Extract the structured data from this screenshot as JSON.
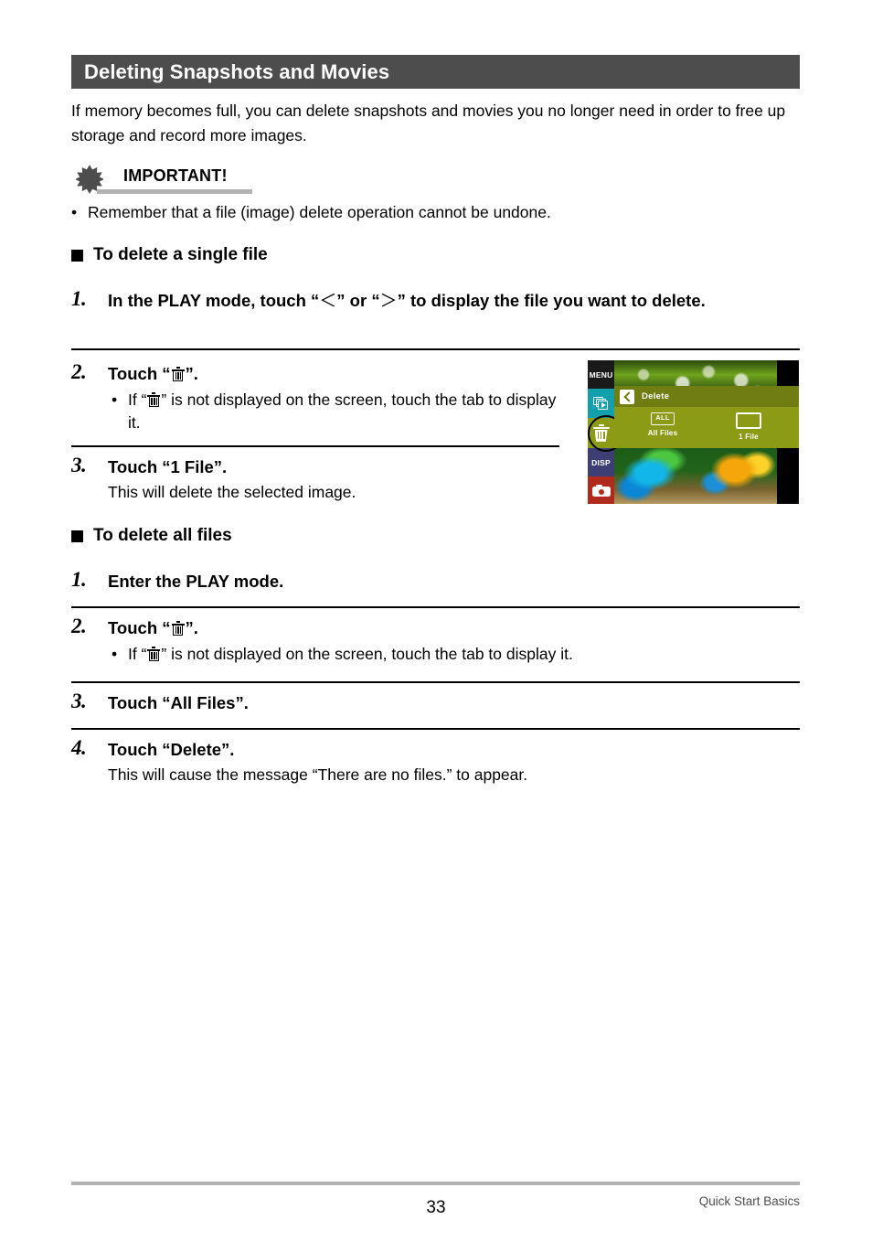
{
  "section": {
    "title": "Deleting Snapshots and Movies",
    "intro": "If memory becomes full, you can delete snapshots and movies you no longer need in order to free up storage and record more images."
  },
  "important": {
    "icon": "starburst-icon",
    "label": "IMPORTANT!",
    "bullet": "Remember that a file (image) delete operation cannot be undone."
  },
  "single_file": {
    "heading": "To delete a single file",
    "step1": {
      "num": "1.",
      "title_pre": "In the PLAY mode, touch “",
      "angle_left": "＜",
      "title_mid": "” or “",
      "angle_right": "＞",
      "title_post": "” to display the file you want to delete."
    },
    "step2": {
      "num": "2.",
      "title_pre": "Touch “",
      "title_post": "”.",
      "bullet_dot": "•",
      "bullet_pre": "If “",
      "bullet_post": "” is not displayed on the screen, touch the tab to display it."
    },
    "step3": {
      "num": "3.",
      "title": "Touch “1 File”.",
      "note": "This will delete the selected image."
    }
  },
  "all_files": {
    "heading": "To delete all files",
    "step1": {
      "num": "1.",
      "title": "Enter the PLAY mode."
    },
    "step2": {
      "num": "2.",
      "title_pre": "Touch “",
      "title_post": "”.",
      "bullet_dot": "•",
      "bullet_pre": "If “",
      "bullet_post": "” is not displayed on the screen, touch the tab to display it."
    },
    "step3": {
      "num": "3.",
      "title": "Touch “All Files”."
    },
    "step4": {
      "num": "4.",
      "title": "Touch “Delete”.",
      "note": "This will cause the message “There are no files.” to appear."
    }
  },
  "lcd": {
    "tabs": [
      {
        "name": "menu-tab",
        "label": "MENU",
        "color": "#1a1a1a"
      },
      {
        "name": "play-tab",
        "label": "",
        "color": "#12a0ad"
      },
      {
        "name": "delete-tab",
        "label": "",
        "color": "#8b9b15"
      },
      {
        "name": "disp-tab",
        "label": "DISP",
        "color": "#3d3f74"
      },
      {
        "name": "camera-tab",
        "label": "",
        "color": "#b02b1e"
      }
    ],
    "panel_title": "Delete",
    "option_all_badge": "ALL",
    "option_all_label": "All Files",
    "option_one_label": "1 File",
    "accent_olive": "#8b9b15",
    "accent_olive_dark": "#6f7d12"
  },
  "footer": {
    "page_number": "33",
    "label": "Quick Start Basics"
  }
}
